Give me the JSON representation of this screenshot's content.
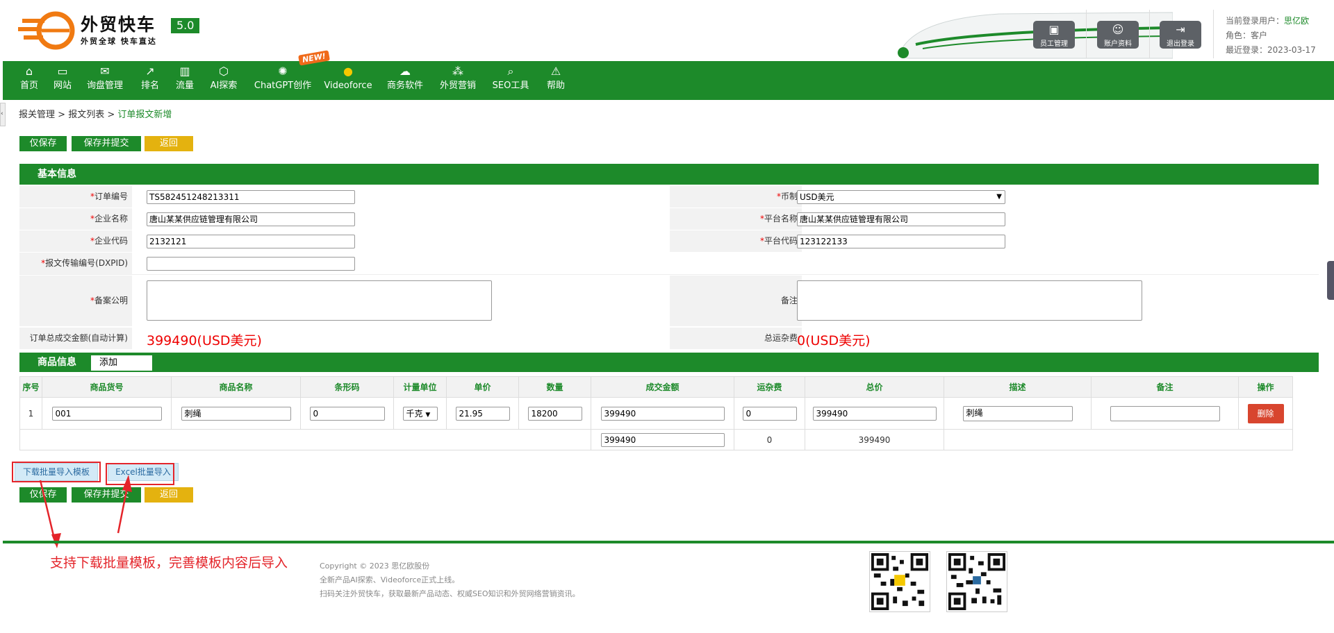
{
  "header": {
    "logo_title": "外贸快车",
    "logo_sub": "外贸全球 快车直达",
    "version": "5.0",
    "buttons": {
      "staff": "员工管理",
      "account": "账户资料",
      "logout": "退出登录"
    },
    "user_label": "当前登录用户：",
    "user_name": "思亿欧",
    "role": "角色：客户",
    "last_login": "最近登录：2023-03-17"
  },
  "nav": {
    "items": [
      "首页",
      "网站",
      "询盘管理",
      "排名",
      "流量",
      "AI探索",
      "ChatGPT创作",
      "Videoforce",
      "商务软件",
      "外贸营销",
      "SEO工具",
      "帮助"
    ],
    "new_badge": "NEW!"
  },
  "breadcrumb": {
    "a": "报关管理",
    "sep": " > ",
    "b": "报文列表",
    "c": "订单报文新增"
  },
  "actions": {
    "save_only": "仅保存",
    "save_submit": "保存并提交",
    "back": "返回"
  },
  "basic": {
    "title": "基本信息",
    "order_no_label": "订单编号",
    "order_no": "TS582451248213311",
    "currency_label": "币制",
    "currency": "USD美元",
    "company_name_label": "企业名称",
    "company_name": "唐山某某供应链管理有限公司",
    "platform_name_label": "平台名称",
    "platform_name": "唐山某某供应链管理有限公司",
    "company_code_label": "企业代码",
    "company_code": "2132121",
    "platform_code_label": "平台代码",
    "platform_code": "123122133",
    "dxpid_label": "报文传输编号(DXPID)",
    "dxpid": "",
    "filing_label": "备案公明",
    "remark_label": "备注",
    "total_label": "订单总成交金额(自动计算)",
    "total": "399490(USD美元)",
    "freight_label": "总运杂费",
    "freight": "0(USD美元)"
  },
  "goods": {
    "title": "商品信息",
    "add": "添加",
    "headers": [
      "序号",
      "商品货号",
      "商品名称",
      "条形码",
      "计量单位",
      "单价",
      "数量",
      "成交金额",
      "运杂费",
      "总价",
      "描述",
      "备注",
      "操作"
    ],
    "row": {
      "idx": "1",
      "sku": "001",
      "name": "刺绳",
      "barcode": "0",
      "unit": "千克",
      "price": "21.95",
      "qty": "18200",
      "amount": "399490",
      "freight": "0",
      "total": "399490",
      "desc": "刺绳",
      "remark": "",
      "op": "删除"
    },
    "sum": {
      "amount": "399490",
      "freight": "0",
      "total": "399490"
    }
  },
  "import": {
    "download": "下载批量导入模板",
    "excel": "Excel批量导入"
  },
  "annotation": "支持下载批量模板，完善模板内容后导入",
  "footer": {
    "copyright": "Copyright © 2023 思亿欧股份",
    "line2": "全新产品AI探索、Videoforce正式上线。",
    "line3": "扫码关注外贸快车，获取最新产品动态、权威SEO知识和外贸网络营销资讯。"
  },
  "colors": {
    "brand": "#1d8a2a",
    "accent_yellow": "#e4b20f",
    "alert_red": "#e00000",
    "delete_red": "#d8452e"
  }
}
